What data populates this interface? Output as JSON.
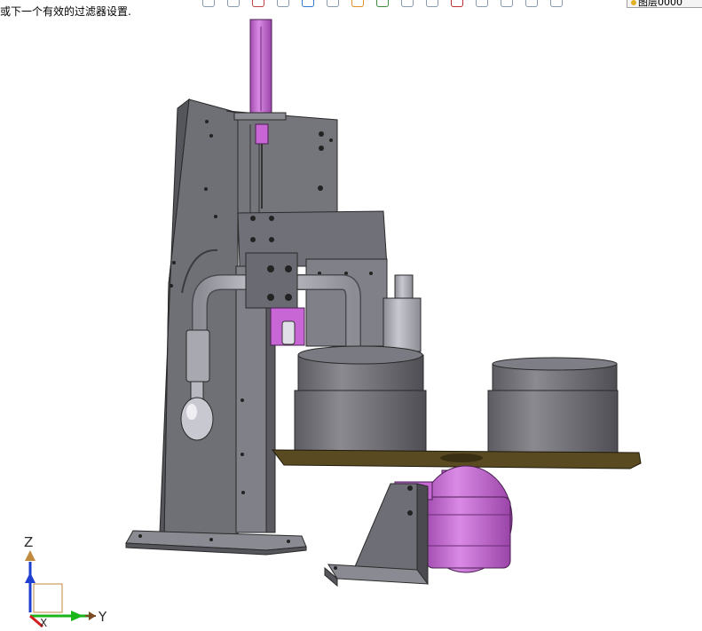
{
  "status_bar": {
    "message": "或下一个有效的过滤器设置."
  },
  "toolbar": {
    "icons": [
      "view-orientation-icon",
      "view-cube-icon",
      "section-view-icon",
      "display-style-icon",
      "shaded-icon",
      "hide-show-icon",
      "edit-appearance-icon",
      "scene-icon",
      "view-settings-icon",
      "realview-icon",
      "shadows-icon",
      "ambient-occlusion-icon",
      "perspective-icon",
      "cartoon-icon",
      "camera-icon"
    ],
    "layer_label": "图层0000"
  },
  "triad": {
    "z_label": "Z",
    "y_label": "Y",
    "x_label": "X"
  },
  "colors": {
    "frame_gray": "#7b7b83",
    "frame_dark": "#4a4a50",
    "pink": "#c766d4",
    "pink_dark": "#8f3f9a",
    "plate_brown": "#5a4a22",
    "tube_gray": "#a8a8b0",
    "axis_blue": "#1f3fd0",
    "axis_green": "#19b51b",
    "axis_red": "#d02020"
  }
}
